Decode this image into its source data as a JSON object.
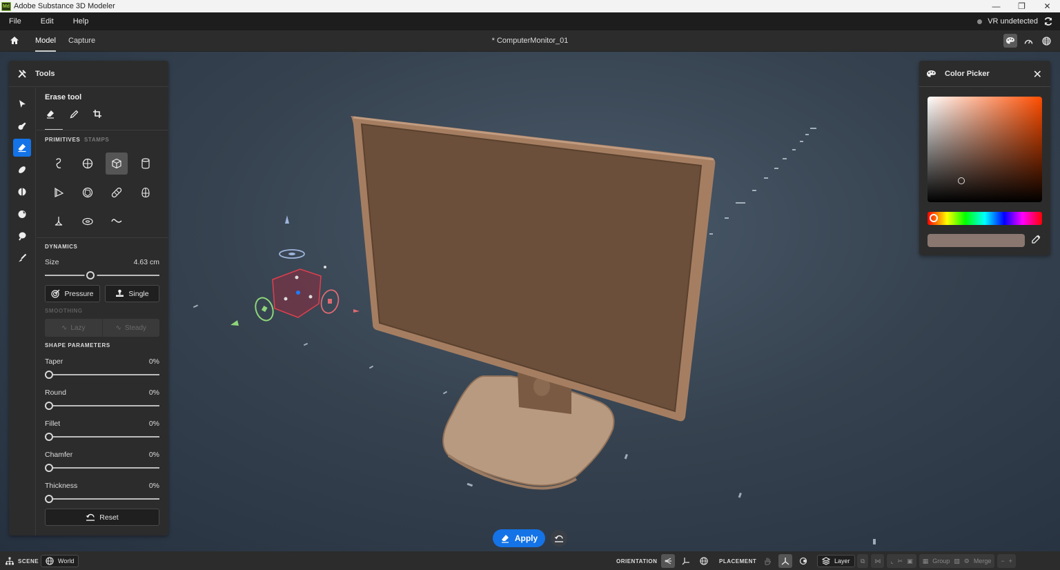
{
  "window": {
    "app_title": "Adobe Substance 3D Modeler",
    "logo_text": "Md",
    "controls": [
      "minimize",
      "restore",
      "close"
    ]
  },
  "menubar": {
    "items": [
      "File",
      "Edit",
      "Help"
    ],
    "vr_status": "VR undetected"
  },
  "tabbar": {
    "tabs": [
      {
        "label": "Model",
        "active": true
      },
      {
        "label": "Capture",
        "active": false
      }
    ],
    "document_title": "* ComputerMonitor_01",
    "right_icons": [
      "color-palette-icon",
      "performance-gauge-icon",
      "globe-icon"
    ]
  },
  "tools_panel": {
    "title": "Tools",
    "rail_tools": [
      "select",
      "clay",
      "erase",
      "smooth",
      "flatten",
      "inflate",
      "move",
      "paint"
    ],
    "active_rail_tool": "erase",
    "tool_title": "Erase tool",
    "sub_modes": [
      "erase",
      "pencil",
      "crop"
    ],
    "primitive_tabs": {
      "primitives": "PRIMITIVES",
      "stamps": "STAMPS"
    },
    "primitives": [
      "curve",
      "sphere",
      "cube",
      "cylinder",
      "pyramid",
      "polyhedron",
      "capsule",
      "egg",
      "cone",
      "torus",
      "wave"
    ],
    "active_primitive": "cube",
    "dynamics": {
      "title": "DYNAMICS",
      "size_label": "Size",
      "size_value": "4.63 cm",
      "size_slider_fraction": 0.4,
      "pressure_label": "Pressure",
      "single_label": "Single"
    },
    "smoothing": {
      "title": "SMOOTHING",
      "lazy_label": "Lazy",
      "steady_label": "Steady"
    },
    "shape_parameters": {
      "title": "SHAPE PARAMETERS",
      "params": [
        {
          "label": "Taper",
          "value": "0%"
        },
        {
          "label": "Round",
          "value": "0%"
        },
        {
          "label": "Fillet",
          "value": "0%"
        },
        {
          "label": "Chamfer",
          "value": "0%"
        },
        {
          "label": "Thickness",
          "value": "0%"
        }
      ],
      "reset_label": "Reset"
    }
  },
  "color_picker": {
    "title": "Color Picker",
    "base_hue": "#ff4d00",
    "selected_color": "#8a7770"
  },
  "viewport": {
    "object_name": "ComputerMonitor_01",
    "apply_label": "Apply"
  },
  "statusbar": {
    "scene_label": "SCENE",
    "world_label": "World",
    "orientation_label": "ORIENTATION",
    "placement_label": "PLACEMENT",
    "layer_label": "Layer",
    "group_label": "Group",
    "merge_label": "Merge"
  }
}
